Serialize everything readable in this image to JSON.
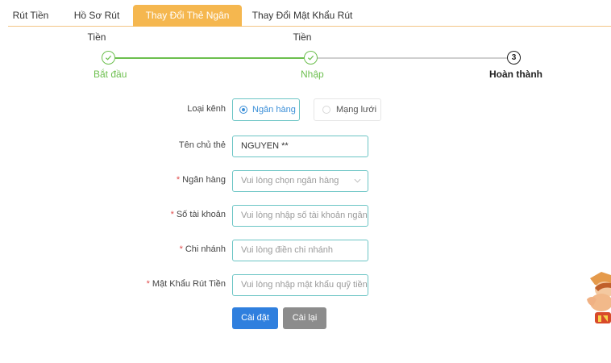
{
  "tabs": [
    {
      "label": "Rút Tiền",
      "active": false
    },
    {
      "label": "Hồ Sơ Rút Tiền",
      "active": false
    },
    {
      "label": "Thay Đổi Thẻ Ngân Hàng",
      "active": true
    },
    {
      "label": "Thay Đổi Mật Khẩu Rút Tiền",
      "active": false
    }
  ],
  "stepper": {
    "steps": [
      {
        "label": "Bắt đầu",
        "status": "done",
        "icon": "check-icon"
      },
      {
        "label": "Nhập",
        "status": "done",
        "icon": "check-icon"
      },
      {
        "label": "Hoàn thành",
        "status": "current",
        "number": "3"
      }
    ],
    "colors": {
      "done": "#6cbf4e",
      "pending": "#cfcfcf"
    }
  },
  "form": {
    "channel": {
      "label": "Loại kênh",
      "options": [
        {
          "label": "Ngân hàng",
          "selected": true
        },
        {
          "label": "Mạng lưới",
          "selected": false
        }
      ]
    },
    "holder": {
      "label": "Tên chủ thẻ",
      "value": "NGUYEN **"
    },
    "bank": {
      "label": "Ngân hàng",
      "required": true,
      "placeholder": "Vui lòng chọn ngân hàng"
    },
    "account": {
      "label": "Số tài khoản",
      "required": true,
      "placeholder": "Vui lòng nhập số tài khoản ngân hà"
    },
    "branch": {
      "label": "Chi nhánh",
      "required": true,
      "placeholder": "Vui lòng điền chi nhánh"
    },
    "password": {
      "label": "Mật Khẩu Rút Tiền",
      "required": true,
      "placeholder": "Vui lòng nhập mật khẩu quỹ tiền"
    }
  },
  "buttons": {
    "submit": "Cài đặt",
    "reset": "Cài lại"
  },
  "colors": {
    "accent_tab": "#f5b74f",
    "primary": "#2f7fde",
    "secondary": "#8c8c8c",
    "required": "#e04b4b",
    "input_border": "#6cc5c5"
  }
}
